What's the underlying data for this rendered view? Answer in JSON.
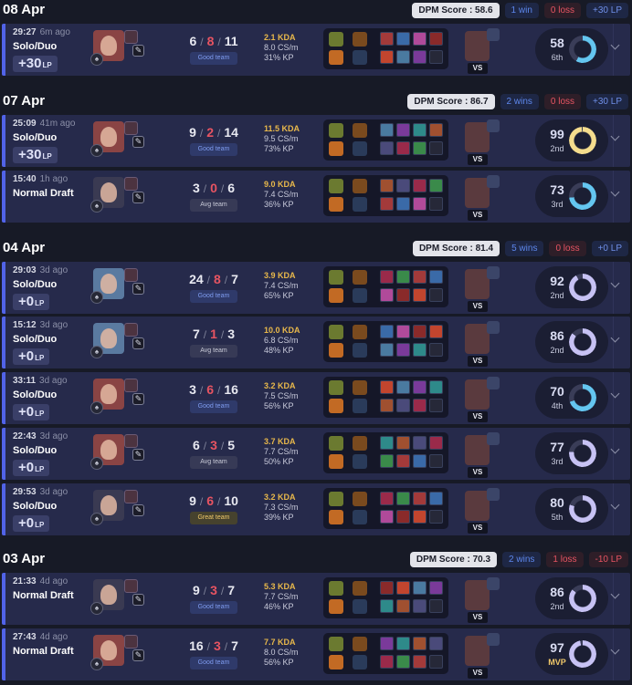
{
  "groups": [
    {
      "date": "08 Apr",
      "dpm": "DPM Score : 58.6",
      "wins": "1 win",
      "losses": "0 loss",
      "lp": "+30 LP",
      "lp_negative": false,
      "matches": [
        {
          "time": "29:27",
          "ago": "6m ago",
          "queue": "Solo/Duo",
          "lp": "+30",
          "lp_unit": "LP",
          "kills": "6",
          "deaths": "8",
          "assists": "11",
          "team": "Good team",
          "team_kind": "good",
          "kda": "2.1 KDA",
          "cs": "8.0 CS/m",
          "kp": "31% KP",
          "score": "58",
          "rank": "6th",
          "ring_color": "#64c6f0",
          "ring_pct": 0.58,
          "champ_color": "#8a4444"
        }
      ]
    },
    {
      "date": "07 Apr",
      "dpm": "DPM Score : 86.7",
      "wins": "2 wins",
      "losses": "0 loss",
      "lp": "+30 LP",
      "lp_negative": false,
      "matches": [
        {
          "time": "25:09",
          "ago": "41m ago",
          "queue": "Solo/Duo",
          "lp": "+30",
          "lp_unit": "LP",
          "kills": "9",
          "deaths": "2",
          "assists": "14",
          "team": "Good team",
          "team_kind": "good",
          "kda": "11.5 KDA",
          "cs": "9.5 CS/m",
          "kp": "73% KP",
          "score": "99",
          "rank": "2nd",
          "ring_color": "#f5dd8d",
          "ring_pct": 0.99,
          "champ_color": "#8a4444"
        },
        {
          "time": "15:40",
          "ago": "1h ago",
          "queue": "Normal Draft",
          "lp": "",
          "lp_unit": "",
          "kills": "3",
          "deaths": "0",
          "assists": "6",
          "team": "Avg team",
          "team_kind": "avg",
          "kda": "9.0 KDA",
          "cs": "7.4 CS/m",
          "kp": "36% KP",
          "score": "73",
          "rank": "3rd",
          "ring_color": "#64c6f0",
          "ring_pct": 0.73,
          "champ_color": "#3a3a52"
        }
      ]
    },
    {
      "date": "04 Apr",
      "dpm": "DPM Score : 81.4",
      "wins": "5 wins",
      "losses": "0 loss",
      "lp": "+0 LP",
      "lp_negative": false,
      "matches": [
        {
          "time": "29:03",
          "ago": "3d ago",
          "queue": "Solo/Duo",
          "lp": "+0",
          "lp_unit": "LP",
          "kills": "24",
          "deaths": "8",
          "assists": "7",
          "team": "Good team",
          "team_kind": "good",
          "kda": "3.9 KDA",
          "cs": "7.4 CS/m",
          "kp": "65% KP",
          "score": "92",
          "rank": "2nd",
          "ring_color": "#c7c2f4",
          "ring_pct": 0.92,
          "champ_color": "#5a7aa0"
        },
        {
          "time": "15:12",
          "ago": "3d ago",
          "queue": "Solo/Duo",
          "lp": "+0",
          "lp_unit": "LP",
          "kills": "7",
          "deaths": "1",
          "assists": "3",
          "team": "Avg team",
          "team_kind": "avg",
          "kda": "10.0 KDA",
          "cs": "6.8 CS/m",
          "kp": "48% KP",
          "score": "86",
          "rank": "2nd",
          "ring_color": "#c7c2f4",
          "ring_pct": 0.86,
          "champ_color": "#5a7aa0"
        },
        {
          "time": "33:11",
          "ago": "3d ago",
          "queue": "Solo/Duo",
          "lp": "+0",
          "lp_unit": "LP",
          "kills": "3",
          "deaths": "6",
          "assists": "16",
          "team": "Good team",
          "team_kind": "good",
          "kda": "3.2 KDA",
          "cs": "7.5 CS/m",
          "kp": "56% KP",
          "score": "70",
          "rank": "4th",
          "ring_color": "#64c6f0",
          "ring_pct": 0.7,
          "champ_color": "#8a4444"
        },
        {
          "time": "22:43",
          "ago": "3d ago",
          "queue": "Solo/Duo",
          "lp": "+0",
          "lp_unit": "LP",
          "kills": "6",
          "deaths": "3",
          "assists": "5",
          "team": "Avg team",
          "team_kind": "avg",
          "kda": "3.7 KDA",
          "cs": "7.7 CS/m",
          "kp": "50% KP",
          "score": "77",
          "rank": "3rd",
          "ring_color": "#c7c2f4",
          "ring_pct": 0.77,
          "champ_color": "#8a4444"
        },
        {
          "time": "29:53",
          "ago": "3d ago",
          "queue": "Solo/Duo",
          "lp": "+0",
          "lp_unit": "LP",
          "kills": "9",
          "deaths": "6",
          "assists": "10",
          "team": "Great team",
          "team_kind": "great",
          "kda": "3.2 KDA",
          "cs": "7.3 CS/m",
          "kp": "39% KP",
          "score": "80",
          "rank": "5th",
          "ring_color": "#c7c2f4",
          "ring_pct": 0.8,
          "champ_color": "#3a3a52"
        }
      ]
    },
    {
      "date": "03 Apr",
      "dpm": "DPM Score : 70.3",
      "wins": "2 wins",
      "losses": "1 loss",
      "lp": "-10 LP",
      "lp_negative": true,
      "matches": [
        {
          "time": "21:33",
          "ago": "4d ago",
          "queue": "Normal Draft",
          "lp": "",
          "lp_unit": "",
          "kills": "9",
          "deaths": "3",
          "assists": "7",
          "team": "Good team",
          "team_kind": "good",
          "kda": "5.3 KDA",
          "cs": "7.7 CS/m",
          "kp": "46% KP",
          "score": "86",
          "rank": "2nd",
          "ring_color": "#c7c2f4",
          "ring_pct": 0.86,
          "champ_color": "#3a3a52"
        },
        {
          "time": "27:43",
          "ago": "4d ago",
          "queue": "Normal Draft",
          "lp": "",
          "lp_unit": "",
          "kills": "16",
          "deaths": "3",
          "assists": "7",
          "team": "Good team",
          "team_kind": "good",
          "kda": "7.7 KDA",
          "cs": "8.0 CS/m",
          "kp": "56% KP",
          "score": "97",
          "rank": "MVP",
          "ring_color": "#c7c2f4",
          "ring_pct": 0.97,
          "champ_color": "#8a4444"
        }
      ]
    }
  ],
  "labels": {
    "vs": "VS"
  },
  "icons": {
    "role": "role-icon",
    "edit": "pencil-icon",
    "expand": "chevron-down-icon"
  }
}
